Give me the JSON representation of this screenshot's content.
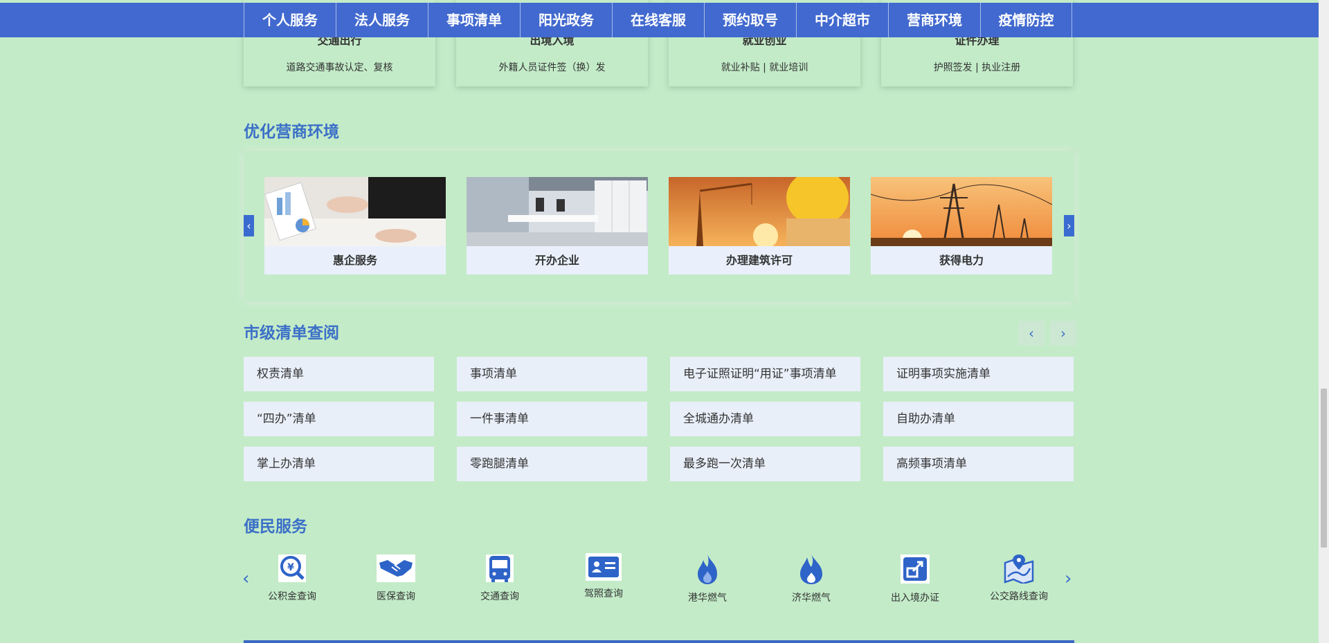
{
  "nav": [
    "个人服务",
    "法人服务",
    "事项清单",
    "阳光政务",
    "在线客服",
    "预约取号",
    "中介超市",
    "营商环境",
    "疫情防控"
  ],
  "service_cards": [
    {
      "title": "交通出行",
      "desc": "道路交通事故认定、复核"
    },
    {
      "title": "出境入境",
      "desc": "外籍人员证件签（换）发"
    },
    {
      "title": "就业创业",
      "desc": "就业补贴  |  就业培训"
    },
    {
      "title": "证件办理",
      "desc": "护照签发  |  执业注册"
    }
  ],
  "business": {
    "title": "优化营商环境",
    "prev": "‹",
    "next": "›",
    "items": [
      "惠企服务",
      "开办企业",
      "办理建筑许可",
      "获得电力"
    ]
  },
  "lists": {
    "title": "市级清单查阅",
    "prev": "‹",
    "next": "›",
    "items": [
      "权责清单",
      "事项清单",
      "电子证照证明“用证”事项清单",
      "证明事项实施清单",
      "“四办”清单",
      "一件事清单",
      "全城通办清单",
      "自助办清单",
      "掌上办清单",
      "零跑腿清单",
      "最多跑一次清单",
      "高频事项清单"
    ]
  },
  "convenience": {
    "title": "便民服务",
    "prev": "‹",
    "next": "›",
    "items": [
      {
        "label": "公积金查询",
        "icon": "yuan-search-icon"
      },
      {
        "label": "医保查询",
        "icon": "handshake-icon"
      },
      {
        "label": "交通查询",
        "icon": "bus-icon"
      },
      {
        "label": "驾照查询",
        "icon": "id-card-icon"
      },
      {
        "label": "港华燃气",
        "icon": "flame-icon"
      },
      {
        "label": "济华燃气",
        "icon": "flame-icon"
      },
      {
        "label": "出入境办证",
        "icon": "exit-entry-icon"
      },
      {
        "label": "公交路线查询",
        "icon": "map-route-icon"
      }
    ]
  },
  "colors": {
    "accent": "#3b6fc7",
    "nav_bg": "#4169cf",
    "page_bg": "#c3ebc8"
  }
}
